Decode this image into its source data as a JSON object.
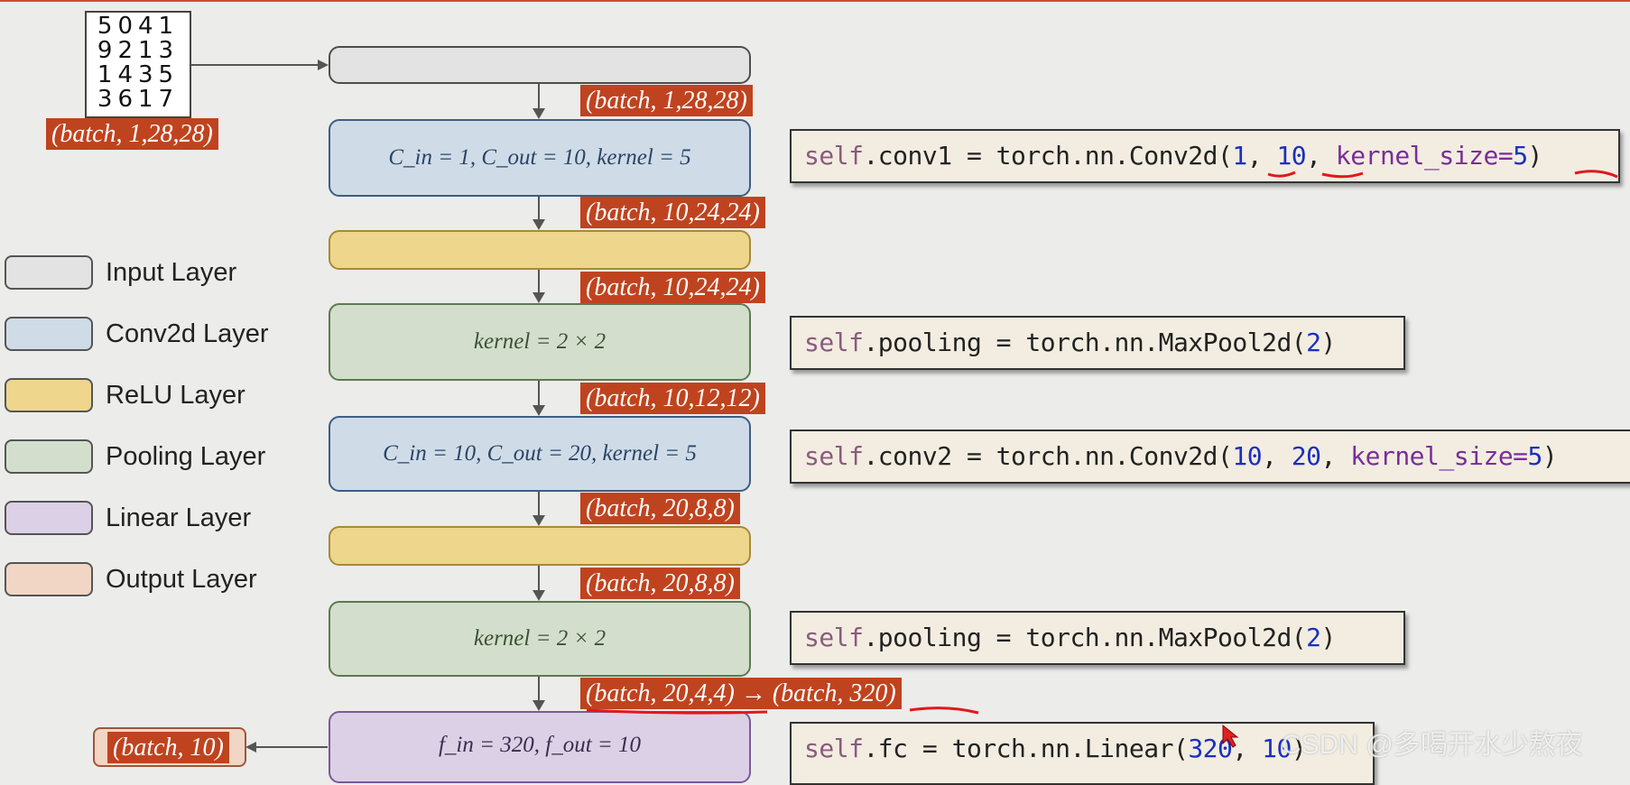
{
  "input_image": {
    "digits_rows": [
      "5041",
      "9213",
      "1435",
      "3617"
    ],
    "shape": "(batch, 1,28,28)"
  },
  "layers": [
    {
      "type": "input",
      "text": ""
    },
    {
      "type": "conv",
      "text": "C_in = 1, C_out = 10, kernel = 5"
    },
    {
      "type": "relu",
      "text": ""
    },
    {
      "type": "pool",
      "text": "kernel = 2 × 2"
    },
    {
      "type": "conv",
      "text": "C_in = 10, C_out = 20, kernel = 5"
    },
    {
      "type": "relu",
      "text": ""
    },
    {
      "type": "pool",
      "text": "kernel = 2 × 2"
    },
    {
      "type": "linear",
      "text": "f_in = 320, f_out = 10"
    }
  ],
  "shapes": [
    "(batch, 1,28,28)",
    "(batch, 10,24,24)",
    "(batch, 10,24,24)",
    "(batch, 10,12,12)",
    "(batch, 20,8,8)",
    "(batch, 20,8,8)",
    "(batch, 20,4,4) → (batch, 320)"
  ],
  "output_shape": "(batch, 10)",
  "code": {
    "conv1": {
      "a": "self",
      "b": ".conv1 = torch.nn.Conv2d(",
      "n1": "1",
      "c": ",  ",
      "n2": "10",
      "d": ",  ",
      "k": "kernel_size=",
      "n3": "5",
      "e": ")"
    },
    "pool1": {
      "a": "self",
      "b": ".pooling = torch.nn.MaxPool2d(",
      "n1": "2",
      "e": ")"
    },
    "conv2": {
      "a": "self",
      "b": ".conv2 = torch.nn.Conv2d(",
      "n1": "10",
      "c": ",  ",
      "n2": "20",
      "d": ",  ",
      "k": "kernel_size=",
      "n3": "5",
      "e": ")"
    },
    "pool2": {
      "a": "self",
      "b": ".pooling = torch.nn.MaxPool2d(",
      "n1": "2",
      "e": ")"
    },
    "fc": {
      "a": "self",
      "b": ".fc = torch.nn.Linear(",
      "n1": "320",
      "c": ",  ",
      "n2": "10",
      "e": ")"
    }
  },
  "legend": [
    {
      "label": "Input Layer",
      "color": "#e3e3e3"
    },
    {
      "label": "Conv2d Layer",
      "color": "#cfdce8"
    },
    {
      "label": "ReLU Layer",
      "color": "#eed68d"
    },
    {
      "label": "Pooling Layer",
      "color": "#d3dfcc"
    },
    {
      "label": "Linear Layer",
      "color": "#dcd0e6"
    },
    {
      "label": "Output Layer",
      "color": "#f1d6c5"
    }
  ],
  "watermark": "CSDN @多喝开水少熬夜",
  "colors": {
    "shape_label": "#c0431f",
    "annotation": "#e3171b"
  }
}
